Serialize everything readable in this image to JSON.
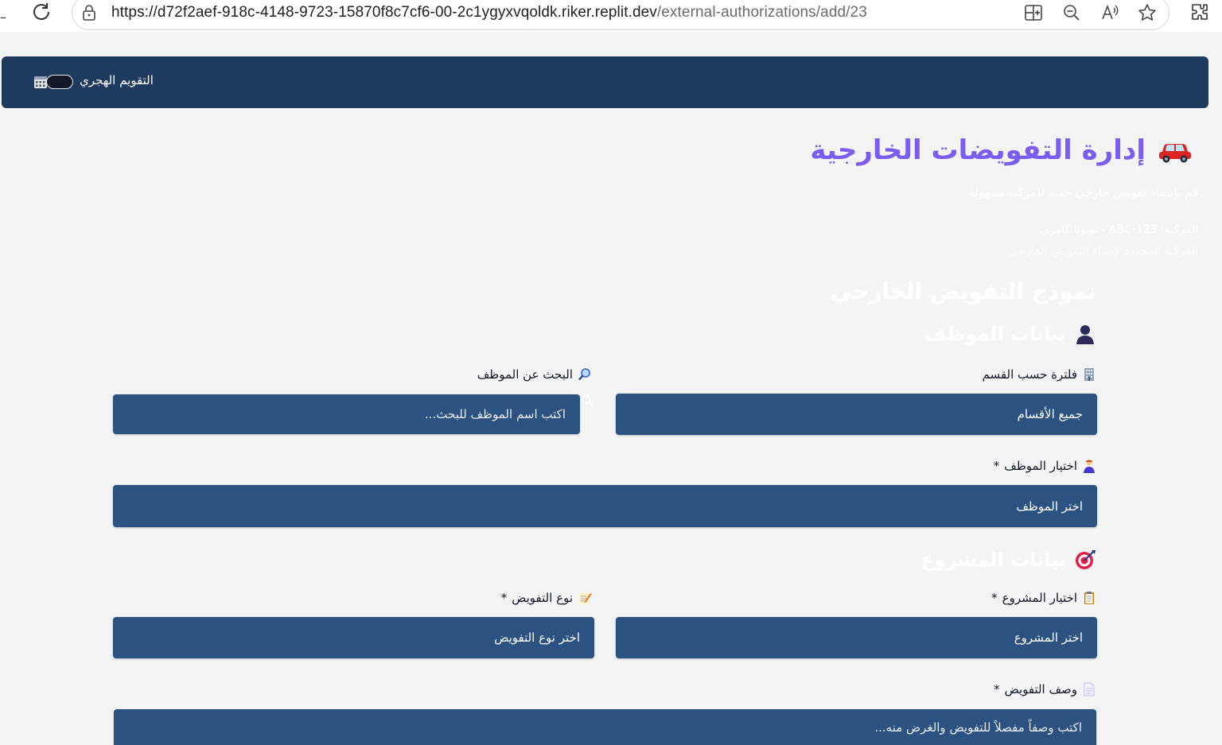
{
  "browser": {
    "url_host": "https://d72f2aef-918c-4148-9723-15870f8c7cf6-00-2c1ygyxvqoldk.riker.replit.dev",
    "url_path": "/external-authorizations/add/23",
    "icons": [
      "reload-icon",
      "lock-icon",
      "split-screen-icon",
      "zoom-out-icon",
      "read-aloud-icon",
      "favorite-star-icon",
      "extensions-icon"
    ]
  },
  "navbar": {
    "hijri_label": "التقويم الهجري",
    "hijri_toggle_on": false,
    "icons": [
      "calendar-icon"
    ]
  },
  "header": {
    "title": "إدارة التفويضات الخارجية",
    "title_icon": "car-icon",
    "subtitle": "قم بإنشاء تفويض خارجي جديد للمركبة بسهولة",
    "vehicle_line": "المركبة: ABC-123 - تويوتا كامري",
    "vehicle_hint": "المركبة المحددة لإنشاء التفويض الخارجي"
  },
  "form": {
    "title": "نموذج التفويض الخارجي",
    "employee_section": {
      "heading": "بيانات الموظف",
      "icon": "person-icon",
      "department_filter": {
        "label": "فلترة حسب القسم",
        "icon": "office-building-icon",
        "value": "جميع الأقسام"
      },
      "employee_search": {
        "label": "البحث عن الموظف",
        "icon": "magnifier-icon",
        "placeholder": "اكتب اسم الموظف للبحث..."
      },
      "employee_select": {
        "label": "اختيار الموظف",
        "required_mark": "*",
        "icon": "worker-icon",
        "value": "اختر الموظف"
      }
    },
    "project_section": {
      "heading": "بيانات المشروع",
      "icon": "target-icon",
      "project_select": {
        "label": "اختيار المشروع",
        "required_mark": "*",
        "icon": "clipboard-icon",
        "value": "اختر المشروع"
      },
      "auth_type_select": {
        "label": "نوع التفويض",
        "required_mark": "*",
        "icon": "memo-icon",
        "value": "اختر نوع التفويض"
      },
      "description": {
        "label": "وصف التفويض",
        "required_mark": "*",
        "icon": "document-icon",
        "placeholder": "اكتب وصفاً مفصلاً للتفويض والغرض منه..."
      }
    }
  },
  "colors": {
    "navbar_bg": "#1e3a5f",
    "field_bg": "#2c5282",
    "title_purple": "#7b5cf0",
    "page_bg": "#f4f4f5"
  }
}
